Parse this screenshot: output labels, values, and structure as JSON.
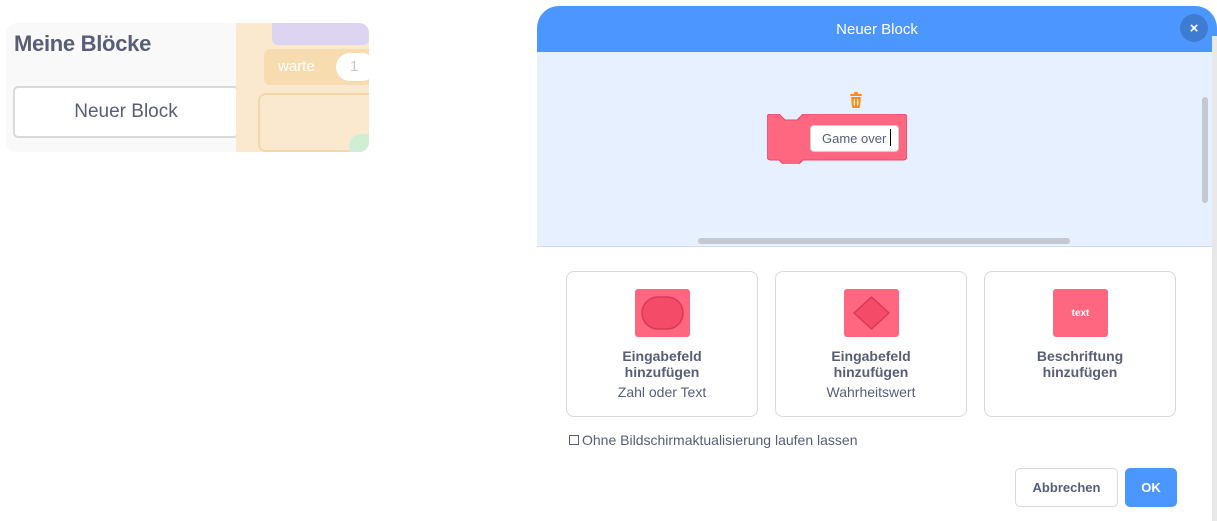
{
  "palette": {
    "title": "Meine Blöcke",
    "new_block_label": "Neuer Block",
    "ghost_block_text": "warte",
    "ghost_block_value": "1"
  },
  "modal": {
    "title": "Neuer Block",
    "close_symbol": "×",
    "block_name_value": "Game over",
    "options": [
      {
        "title_line1": "Eingabefeld",
        "title_line2": "hinzufügen",
        "subtitle": "Zahl oder Text",
        "icon": "round-input-icon"
      },
      {
        "title_line1": "Eingabefeld",
        "title_line2": "hinzufügen",
        "subtitle": "Wahrheitswert",
        "icon": "boolean-input-icon"
      },
      {
        "title_line1": "Beschriftung",
        "title_line2": "hinzufügen",
        "subtitle": "",
        "icon": "label-text-icon",
        "icon_text": "text"
      }
    ],
    "run_without_refresh_label": "Ohne Bildschirmaktualisierung laufen lassen",
    "run_without_refresh_checked": false,
    "cancel_label": "Abbrechen",
    "ok_label": "OK"
  },
  "colors": {
    "header_blue": "#4c97ff",
    "block_pink": "#ff6680",
    "workspace_bg": "#e6f0ff",
    "trash_orange": "#ff8c1a"
  }
}
